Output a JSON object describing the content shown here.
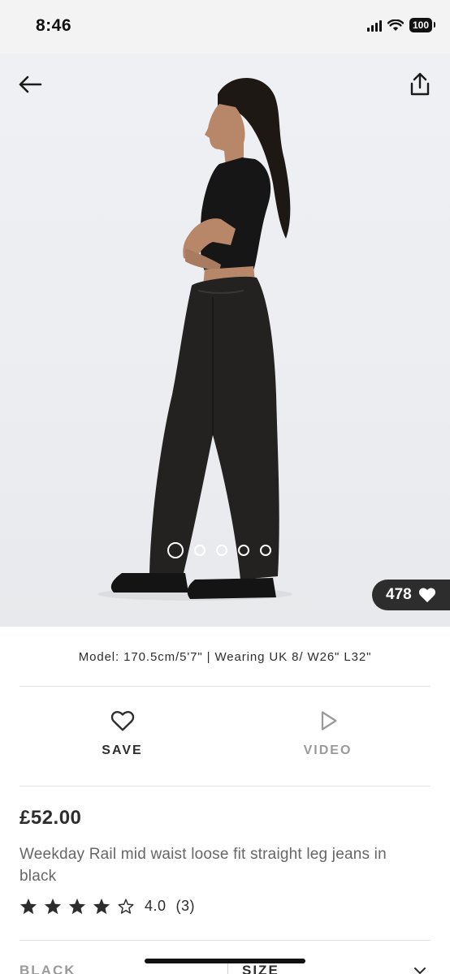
{
  "status_bar": {
    "time": "8:46",
    "battery": "100"
  },
  "gallery": {
    "total_images": 5,
    "active_index": 0,
    "likes": "478"
  },
  "model_info": "Model: 170.5cm/5'7\" | Wearing UK 8/ W26\" L32\"",
  "actions": {
    "save_label": "SAVE",
    "video_label": "VIDEO"
  },
  "product": {
    "price": "£52.00",
    "title": "Weekday Rail mid waist loose fit straight leg jeans in black",
    "rating_value": "4.0",
    "rating_count": "(3)",
    "stars_filled": 4,
    "stars_total": 5
  },
  "selectors": {
    "colour_label": "BLACK",
    "size_label": "SIZE"
  },
  "colors": {
    "text": "#2d2d2d",
    "muted": "#9a9a9a",
    "likes_bg": "#2d2d2d",
    "hero_bg": "#eef0f4"
  },
  "icons": {
    "back": "arrow-left-icon",
    "share": "share-icon",
    "heart": "heart-icon",
    "video": "play-icon",
    "star": "star-icon"
  }
}
